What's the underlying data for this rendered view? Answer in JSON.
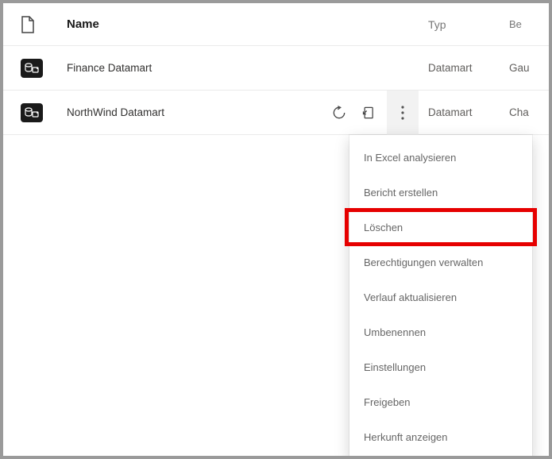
{
  "header": {
    "name_label": "Name",
    "type_label": "Typ",
    "owner_label": "Be"
  },
  "rows": [
    {
      "name": "Finance Datamart",
      "type": "Datamart",
      "owner": "Gau"
    },
    {
      "name": "NorthWind Datamart",
      "type": "Datamart",
      "owner": "Cha"
    }
  ],
  "context_menu": {
    "items": [
      "In Excel analysieren",
      "Bericht erstellen",
      "Löschen",
      "Berechtigungen verwalten",
      "Verlauf aktualisieren",
      "Umbenennen",
      "Einstellungen",
      "Freigeben",
      "Herkunft anzeigen"
    ]
  }
}
